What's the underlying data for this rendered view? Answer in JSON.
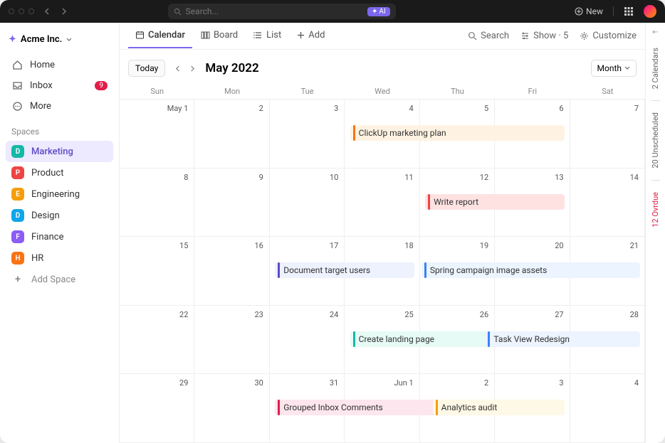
{
  "titlebar": {
    "search_placeholder": "Search...",
    "ai_label": "AI",
    "new_label": "New"
  },
  "sidebar": {
    "org_name": "Acme Inc.",
    "nav": [
      {
        "label": "Home",
        "icon": "home"
      },
      {
        "label": "Inbox",
        "icon": "inbox",
        "badge": "9"
      },
      {
        "label": "More",
        "icon": "more"
      }
    ],
    "section_label": "Spaces",
    "spaces": [
      {
        "letter": "D",
        "label": "Marketing",
        "color": "#14b8a6",
        "selected": true
      },
      {
        "letter": "P",
        "label": "Product",
        "color": "#ef4444"
      },
      {
        "letter": "E",
        "label": "Engineering",
        "color": "#f59e0b"
      },
      {
        "letter": "D",
        "label": "Design",
        "color": "#0ea5e9"
      },
      {
        "letter": "F",
        "label": "Finance",
        "color": "#8b5cf6"
      },
      {
        "letter": "H",
        "label": "HR",
        "color": "#f97316"
      }
    ],
    "add_space": "Add Space"
  },
  "toolbar": {
    "views": [
      {
        "label": "Calendar",
        "active": true
      },
      {
        "label": "Board"
      },
      {
        "label": "List"
      },
      {
        "label": "Add"
      }
    ],
    "search": "Search",
    "show": "Show · 5",
    "customize": "Customize"
  },
  "calendar": {
    "today": "Today",
    "title": "May 2022",
    "month_label": "Month",
    "weekdays": [
      "Sun",
      "Mon",
      "Tue",
      "Wed",
      "Thu",
      "Fri",
      "Sat"
    ],
    "days": [
      "May 1",
      "2",
      "3",
      "4",
      "5",
      "6",
      "7",
      "8",
      "9",
      "10",
      "11",
      "12",
      "13",
      "14",
      "15",
      "16",
      "17",
      "18",
      "19",
      "20",
      "21",
      "22",
      "23",
      "24",
      "25",
      "26",
      "27",
      "28",
      "29",
      "30",
      "31",
      "Jun 1",
      "2",
      "3",
      "4"
    ],
    "events": [
      {
        "label": "ClickUp marketing plan",
        "row": 0,
        "start": 3,
        "end": 5,
        "bar": "#f97316",
        "bg": "#fef3e2"
      },
      {
        "label": "Write report",
        "row": 1,
        "start": 4,
        "end": 5,
        "bar": "#ef4444",
        "bg": "#fee2e2"
      },
      {
        "label": "Document target users",
        "row": 2,
        "start": 2,
        "end": 3,
        "bar": "#5b4bc7",
        "bg": "#eef2ff"
      },
      {
        "label": "Spring campaign image assets",
        "row": 2,
        "start": 3.95,
        "end": 6,
        "bar": "#3b82f6",
        "bg": "#ecf4ff"
      },
      {
        "label": "Create landing page",
        "row": 3,
        "start": 3,
        "end": 4,
        "bar": "#14b8a6",
        "bg": "#e6fbf6"
      },
      {
        "label": "Task View Redesign",
        "row": 3,
        "start": 4.8,
        "end": 6,
        "bar": "#3b82f6",
        "bg": "#ecf4ff"
      },
      {
        "label": "Grouped Inbox Comments",
        "row": 4,
        "start": 2,
        "end": 3.5,
        "bar": "#e11d48",
        "bg": "#fde6ee"
      },
      {
        "label": "Analytics audit",
        "row": 4,
        "start": 4.1,
        "end": 5,
        "bar": "#f59e0b",
        "bg": "#fef8e7"
      }
    ]
  },
  "rail": {
    "calendars": "2 Calendars",
    "unscheduled": "20 Unscheduled",
    "overdue": "12 Ovrdue"
  }
}
